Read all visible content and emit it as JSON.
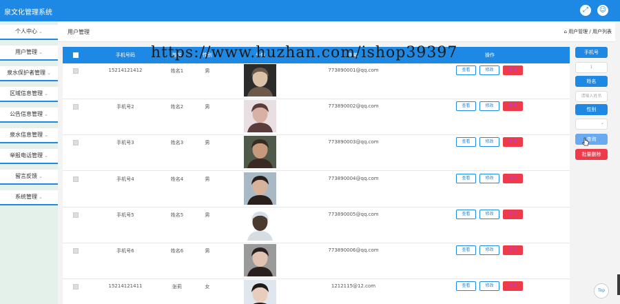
{
  "app": {
    "title": "泉文化管理系统",
    "icons": [
      "fullscreen-icon",
      "user-icon"
    ],
    "accent_color": "#1e88e5",
    "danger_color": "#ef3a4a"
  },
  "sidebar": {
    "items": [
      {
        "label": "个人中心"
      },
      {
        "label": "用户管理"
      },
      {
        "label": "泉水保护者管理"
      },
      {
        "label": "区域信息管理"
      },
      {
        "label": "公告信息管理"
      },
      {
        "label": "泉水信息管理"
      },
      {
        "label": "举报电话管理"
      },
      {
        "label": "留言反馈"
      },
      {
        "label": "系统管理"
      }
    ]
  },
  "breadcrumb": {
    "page_title": "用户管理",
    "path": "用户管理 / 用户列表"
  },
  "table": {
    "headers": [
      "手机号码",
      "姓名",
      "性别",
      "头像",
      "邮箱",
      "操作"
    ],
    "rows": [
      {
        "phone": "15214121412",
        "name": "姓名1",
        "gender": "男",
        "email": "773890001@qq.com"
      },
      {
        "phone": "手机号2",
        "name": "姓名2",
        "gender": "男",
        "email": "773890002@qq.com"
      },
      {
        "phone": "手机号3",
        "name": "姓名3",
        "gender": "男",
        "email": "773890003@qq.com"
      },
      {
        "phone": "手机号4",
        "name": "姓名4",
        "gender": "男",
        "email": "773890004@qq.com"
      },
      {
        "phone": "手机号5",
        "name": "姓名5",
        "gender": "男",
        "email": "773890005@qq.com"
      },
      {
        "phone": "手机号6",
        "name": "姓名6",
        "gender": "男",
        "email": "773890006@qq.com"
      },
      {
        "phone": "15214121411",
        "name": "张莉",
        "gender": "女",
        "email": "1212115@12.com"
      }
    ],
    "actions": {
      "view": "查看",
      "edit": "修改",
      "delete": "删除"
    }
  },
  "search_panel": {
    "phone_label": "手机号",
    "phone_value": "1",
    "name_label": "姓名",
    "name_placeholder": "请输入姓名",
    "gender_label": "性别",
    "gender_value": "",
    "query_label": "查询",
    "batch_delete_label": "批量删除"
  },
  "scroll_top_label": "Top",
  "watermark": "https://www.huzhan.com/ishop39397"
}
